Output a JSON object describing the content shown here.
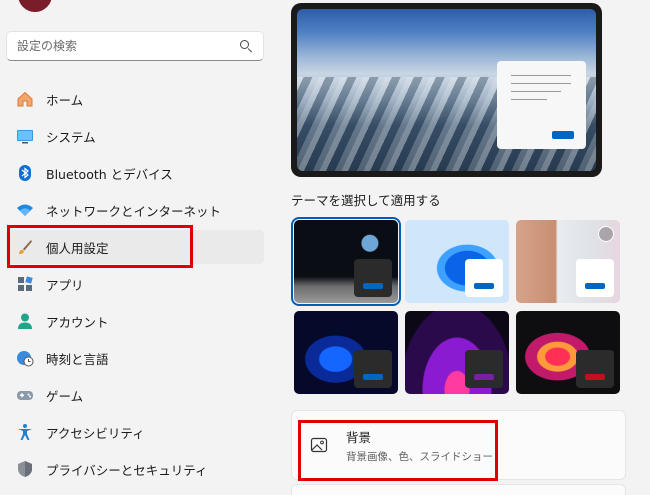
{
  "search": {
    "placeholder": "設定の検索"
  },
  "sidebar": {
    "items": [
      {
        "label": "ホーム",
        "icon": "home-icon"
      },
      {
        "label": "システム",
        "icon": "monitor-icon"
      },
      {
        "label": "Bluetooth とデバイス",
        "icon": "bluetooth-icon"
      },
      {
        "label": "ネットワークとインターネット",
        "icon": "wifi-icon"
      },
      {
        "label": "個人用設定",
        "icon": "paintbrush-icon",
        "active": true
      },
      {
        "label": "アプリ",
        "icon": "apps-icon"
      },
      {
        "label": "アカウント",
        "icon": "person-icon"
      },
      {
        "label": "時刻と言語",
        "icon": "globe-clock-icon"
      },
      {
        "label": "ゲーム",
        "icon": "gamepad-icon"
      },
      {
        "label": "アクセシビリティ",
        "icon": "accessibility-icon"
      },
      {
        "label": "プライバシーとセキュリティ",
        "icon": "shield-icon"
      }
    ]
  },
  "main": {
    "theme_section_label": "テーマを選択して適用する",
    "themes": [
      {
        "name": "theme-earth",
        "accent": "#0067c0",
        "selected": true
      },
      {
        "name": "theme-bloom-light",
        "accent": "#0067c0"
      },
      {
        "name": "theme-spotlight",
        "accent": "#0067c0"
      },
      {
        "name": "theme-bloom-dark",
        "accent": "#0067c0"
      },
      {
        "name": "theme-glow",
        "accent": "#7a1fa2"
      },
      {
        "name": "theme-flow",
        "accent": "#c50f1f"
      }
    ],
    "background_card": {
      "title": "背景",
      "subtitle": "背景画像、色、スライドショー"
    }
  },
  "colors": {
    "highlight": "#e00000",
    "accent": "#0067c0"
  }
}
